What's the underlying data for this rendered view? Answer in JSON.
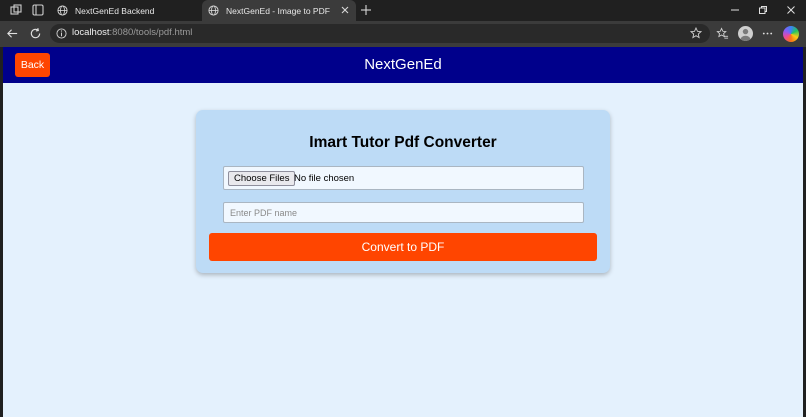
{
  "browser": {
    "tabs": [
      {
        "title": "NextGenEd Backend",
        "active": false
      },
      {
        "title": "NextGenEd - Image to PDF",
        "active": true
      }
    ],
    "address": {
      "host": "localhost",
      "path": ":8080/tools/pdf.html"
    },
    "icons": [
      "workspaces-icon",
      "tab-actions-icon",
      "globe-icon",
      "close-icon",
      "new-tab-icon",
      "back-icon",
      "reload-icon",
      "site-info-icon",
      "favorite-star-icon",
      "favorites-icon",
      "profile-avatar",
      "more-icon",
      "copilot-icon",
      "minimize-icon",
      "restore-icon",
      "window-close-icon"
    ]
  },
  "app": {
    "back_label": "Back",
    "brand": "NextGenEd",
    "header_color": "#00008b",
    "accent_color": "#ff4500",
    "page_bg": "#e4f1fd"
  },
  "converter": {
    "title": "Imart Tutor Pdf Converter",
    "choose_files_label": "Choose Files",
    "file_status": "No file chosen",
    "pdf_name_placeholder": "Enter PDF name",
    "pdf_name_value": "",
    "convert_label": "Convert to PDF"
  }
}
